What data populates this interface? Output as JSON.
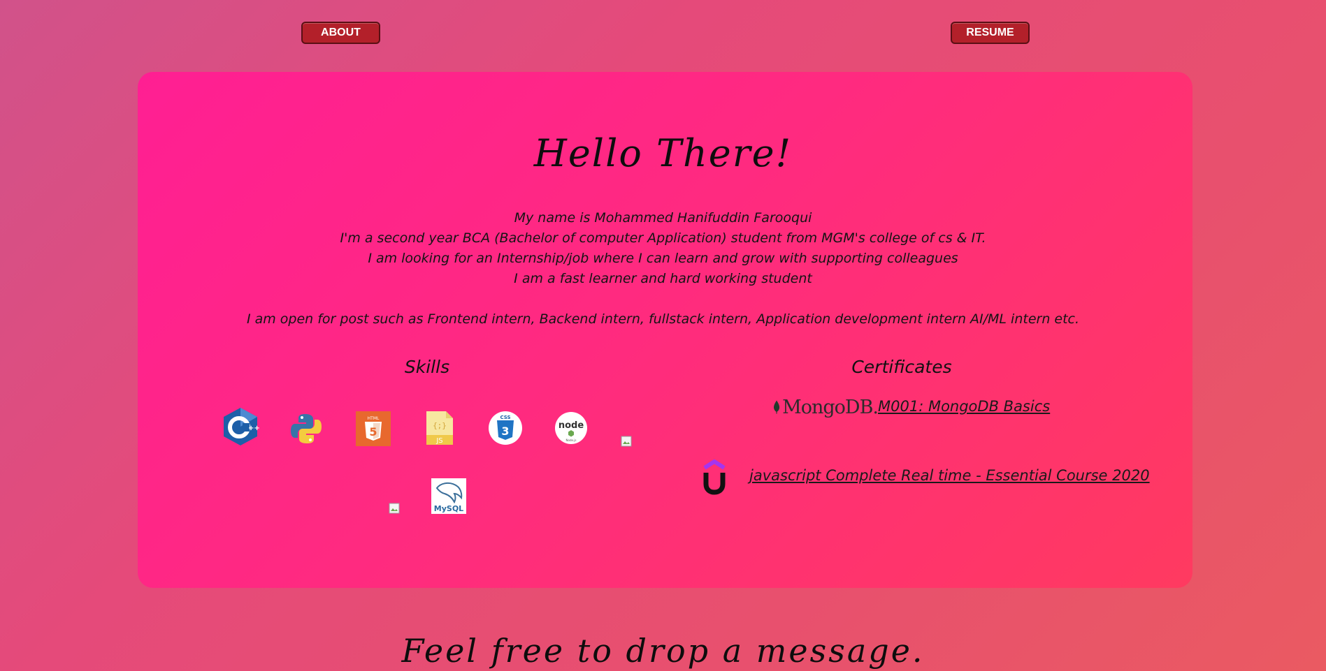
{
  "nav": {
    "about_label": "ABOUT",
    "resume_label": "RESUME"
  },
  "hero": {
    "greeting": "Hello There!",
    "intro_lines": [
      "My name is Mohammed Hanifuddin Farooqui",
      "I'm a second year BCA (Bachelor of computer Application) student from MGM's college of cs & IT.",
      "I am looking for an Internship/job where I can learn and grow with supporting colleagues",
      "I am a fast learner and hard working student"
    ],
    "open_for": "I am open for post such as Frontend intern, Backend intern, fullstack intern, Application development intern AI/ML intern etc."
  },
  "skills": {
    "title": "Skills",
    "icons": [
      "cpp-icon",
      "python-icon",
      "html5-icon",
      "javascript-file-icon",
      "css3-icon",
      "nodejs-icon",
      "broken-image-icon",
      "broken-image-icon",
      "mysql-icon"
    ],
    "badge_text": {
      "html5": "HTML",
      "js_braces": "{;}",
      "js": "JS",
      "css": "CSS",
      "node": "node",
      "nodejs": "Node.js",
      "mysql": "MySQL"
    }
  },
  "certificates": {
    "title": "Certificates",
    "items": [
      {
        "provider": "MongoDB.",
        "icon": "mongodb-leaf-icon",
        "label": "M001: MongoDB Basics"
      },
      {
        "provider": "",
        "icon": "udemy-icon",
        "label": "javascript Complete Real time - Essential Course 2020"
      }
    ]
  },
  "footer": {
    "message": "Feel free to drop a message."
  },
  "colors": {
    "button_bg": "#b3202a",
    "card_start": "#ff1f93",
    "card_end": "#ff3a60"
  }
}
